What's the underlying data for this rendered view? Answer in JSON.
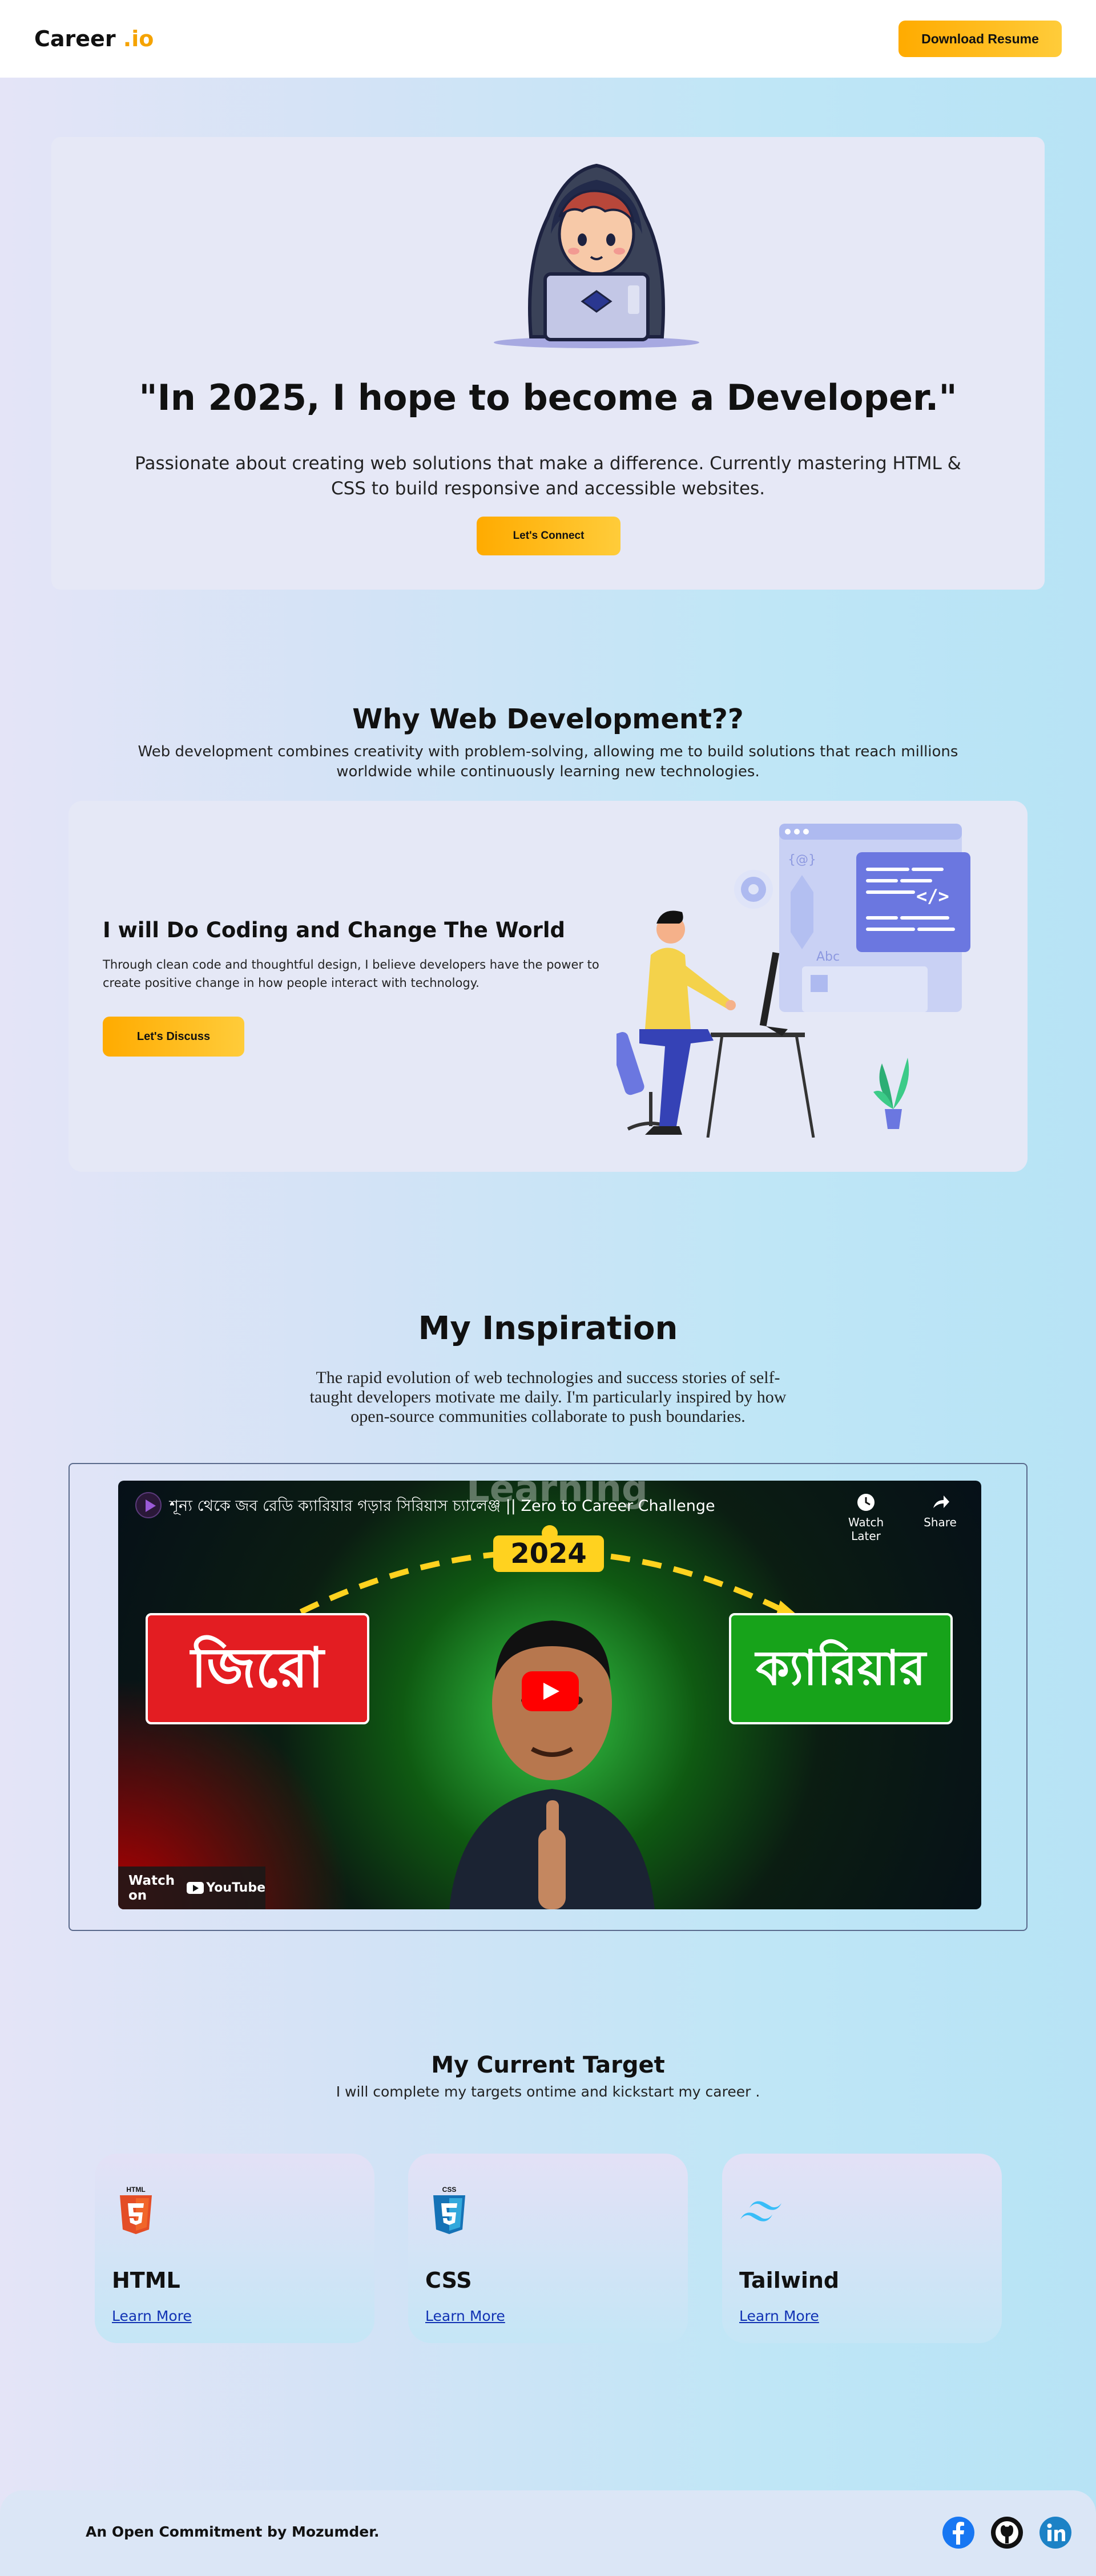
{
  "navbar": {
    "brand_main": "Career",
    "brand_accent": ".io",
    "download_button": "Download Resume"
  },
  "hero": {
    "title": "\"In 2025, I hope to become a Developer.\"",
    "subtitle": "Passionate about creating web solutions that make a difference. Currently mastering HTML & CSS to build responsive and accessible websites.",
    "button": "Let's Connect"
  },
  "why": {
    "title": "Why Web Development??",
    "subtitle": "Web development combines creativity with problem-solving, allowing me to build solutions that reach millions worldwide while continuously learning new technologies.",
    "card_title": "I will Do Coding and Change The World",
    "card_text": "Through clean code and thoughtful design, I believe developers have the power to create positive change in how people interact with technology.",
    "card_button": "Let's Discuss",
    "illustration_labels": {
      "braces": "{@}",
      "abc": "Abc",
      "code": "</>"
    }
  },
  "inspiration": {
    "title": "My Inspiration",
    "subtitle": "The rapid evolution of web technologies and success stories of self-taught developers motivate me daily. I'm particularly inspired by how open-source communities collaborate to push boundaries.",
    "video": {
      "title": "শূন্য থেকে জব রেডি ক্যারিয়ার গড়ার সিরিয়াস চ্যালেঞ্জ || Zero to Career Challenge",
      "overlay_learning": "Learning",
      "year": "2024",
      "left_word": "জিরো",
      "right_word": "ক্যারিয়ার",
      "watch_later": "Watch Later",
      "share": "Share",
      "watch_on": "Watch on",
      "youtube": "YouTube"
    }
  },
  "target": {
    "title": "My Current Target",
    "subtitle": "I will complete my targets ontime and kickstart my career .",
    "cards": [
      {
        "name": "HTML",
        "link": "Learn More",
        "icon_label": "HTML"
      },
      {
        "name": "CSS",
        "link": "Learn More",
        "icon_label": "CSS"
      },
      {
        "name": "Tailwind",
        "link": "Learn More"
      }
    ]
  },
  "footer": {
    "text": "An Open Commitment by Mozumder.",
    "socials": [
      "facebook-icon",
      "github-icon",
      "linkedin-icon"
    ]
  },
  "colors": {
    "accent": "#ffab00",
    "html": "#e44d26",
    "css": "#1572b6",
    "tailwind": "#38bdf8"
  }
}
